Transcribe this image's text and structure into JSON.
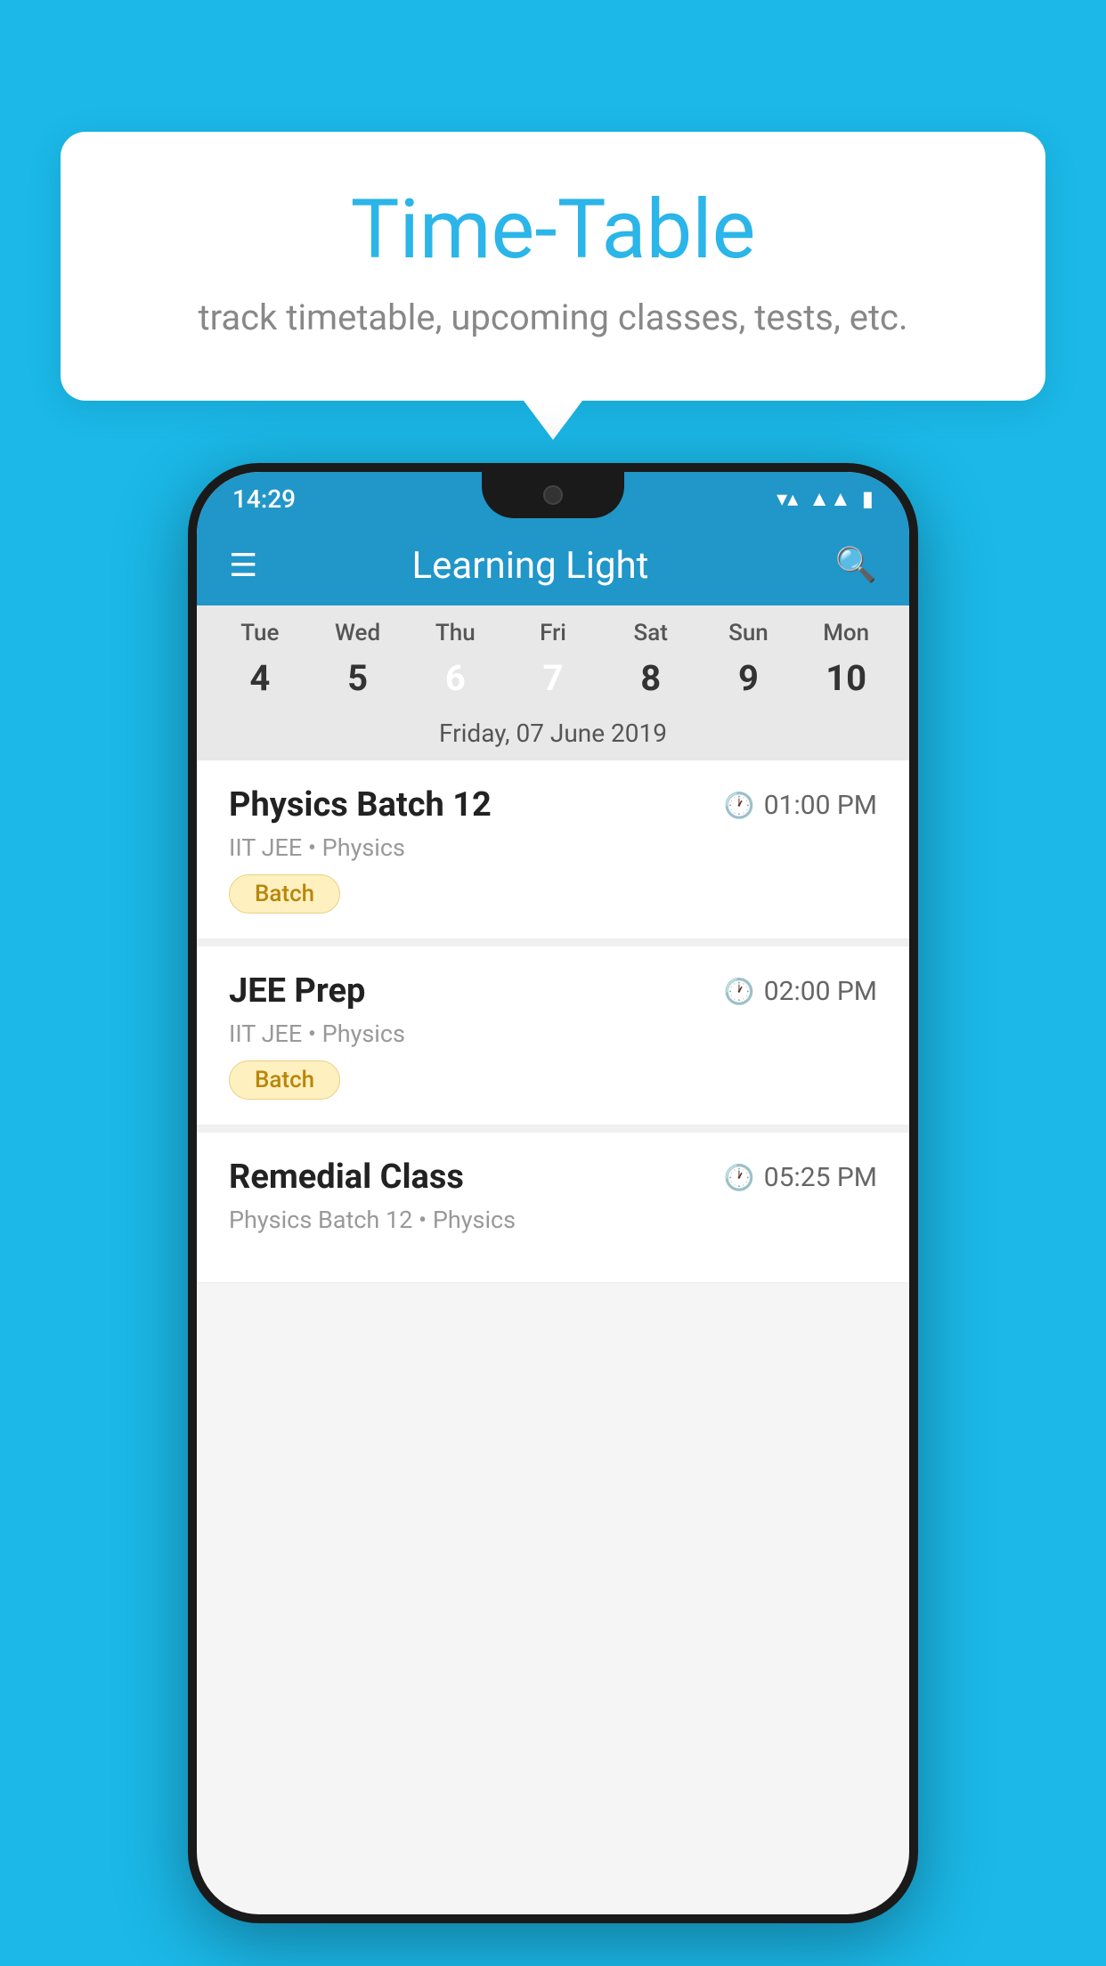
{
  "background": {
    "color": "#1BB8E8"
  },
  "tooltip": {
    "title": "Time-Table",
    "subtitle": "track timetable, upcoming classes, tests, etc."
  },
  "phone": {
    "statusBar": {
      "time": "14:29"
    },
    "appBar": {
      "title": "Learning Light"
    },
    "calendar": {
      "days": [
        {
          "label": "Tue",
          "num": "4"
        },
        {
          "label": "Wed",
          "num": "5"
        },
        {
          "label": "Thu",
          "num": "6",
          "state": "today"
        },
        {
          "label": "Fri",
          "num": "7",
          "state": "selected"
        },
        {
          "label": "Sat",
          "num": "8"
        },
        {
          "label": "Sun",
          "num": "9"
        },
        {
          "label": "Mon",
          "num": "10"
        }
      ],
      "dateLabel": "Friday, 07 June 2019"
    },
    "schedule": [
      {
        "title": "Physics Batch 12",
        "time": "01:00 PM",
        "sub": "IIT JEE • Physics",
        "badge": "Batch"
      },
      {
        "title": "JEE Prep",
        "time": "02:00 PM",
        "sub": "IIT JEE • Physics",
        "badge": "Batch"
      },
      {
        "title": "Remedial Class",
        "time": "05:25 PM",
        "sub": "Physics Batch 12 • Physics",
        "badge": null
      }
    ]
  }
}
